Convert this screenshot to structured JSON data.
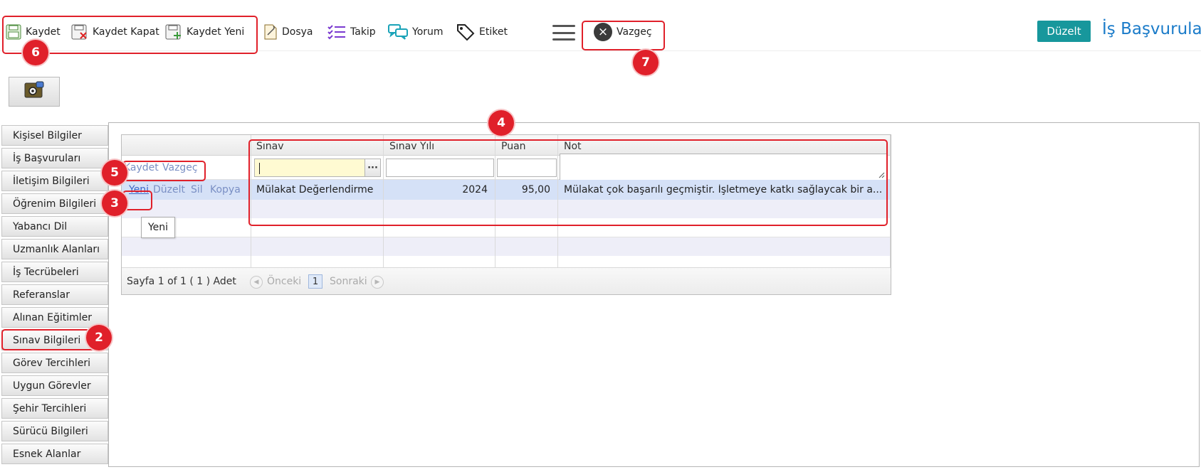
{
  "toolbar": {
    "kaydet": "Kaydet",
    "kaydet_kapat": "Kaydet Kapat",
    "kaydet_yeni": "Kaydet Yeni",
    "dosya": "Dosya",
    "takip": "Takip",
    "yorum": "Yorum",
    "etiket": "Etiket",
    "vazgec": "Vazgeç",
    "vazgec_icon": "×",
    "duzelt": "Düzelt",
    "page_title": "İş Başvuruları"
  },
  "sidebar": {
    "items": [
      {
        "label": "Kişisel Bilgiler"
      },
      {
        "label": "İş Başvuruları"
      },
      {
        "label": "İletişim Bilgileri"
      },
      {
        "label": "Öğrenim Bilgileri"
      },
      {
        "label": "Yabancı Dil"
      },
      {
        "label": "Uzmanlık Alanları"
      },
      {
        "label": "İş Tecrübeleri"
      },
      {
        "label": "Referanslar"
      },
      {
        "label": "Alınan Eğitimler"
      },
      {
        "label": "Sınav Bilgileri"
      },
      {
        "label": "Görev Tercihleri"
      },
      {
        "label": "Uygun Görevler"
      },
      {
        "label": "Şehir Tercihleri"
      },
      {
        "label": "Sürücü Bilgileri"
      },
      {
        "label": "Esnek Alanlar"
      }
    ]
  },
  "grid": {
    "columns": [
      "Sınav",
      "Sınav Yılı",
      "Puan",
      "Not"
    ],
    "edit_actions": {
      "kaydet": "Kaydet",
      "vazgec": "Vazgeç"
    },
    "edit_dots": "···",
    "row_actions": {
      "yeni": "Yeni",
      "duzelt": "Düzelt",
      "sil": "Sil",
      "kopya": "Kopya"
    },
    "rows": [
      {
        "sinav": "Mülakat Değerlendirme",
        "yil": "2024",
        "puan": "95,00",
        "not": "Mülakat çok başarılı geçmiştir. İşletmeye katkı sağlaycak bir a..."
      }
    ],
    "tooltip": "Yeni",
    "pager": {
      "summary": "Sayfa 1 of 1 ( 1 ) Adet",
      "prev": "Önceki",
      "page": "1",
      "next": "Sonraki",
      "prev_icon": "◀",
      "next_icon": "▶"
    }
  },
  "badges": {
    "b2": "2",
    "b3": "3",
    "b4": "4",
    "b5": "5",
    "b6": "6",
    "b7": "7"
  },
  "colors": {
    "accent": "#17979c",
    "title": "#1a7bc9",
    "highlight": "#e0202a"
  }
}
